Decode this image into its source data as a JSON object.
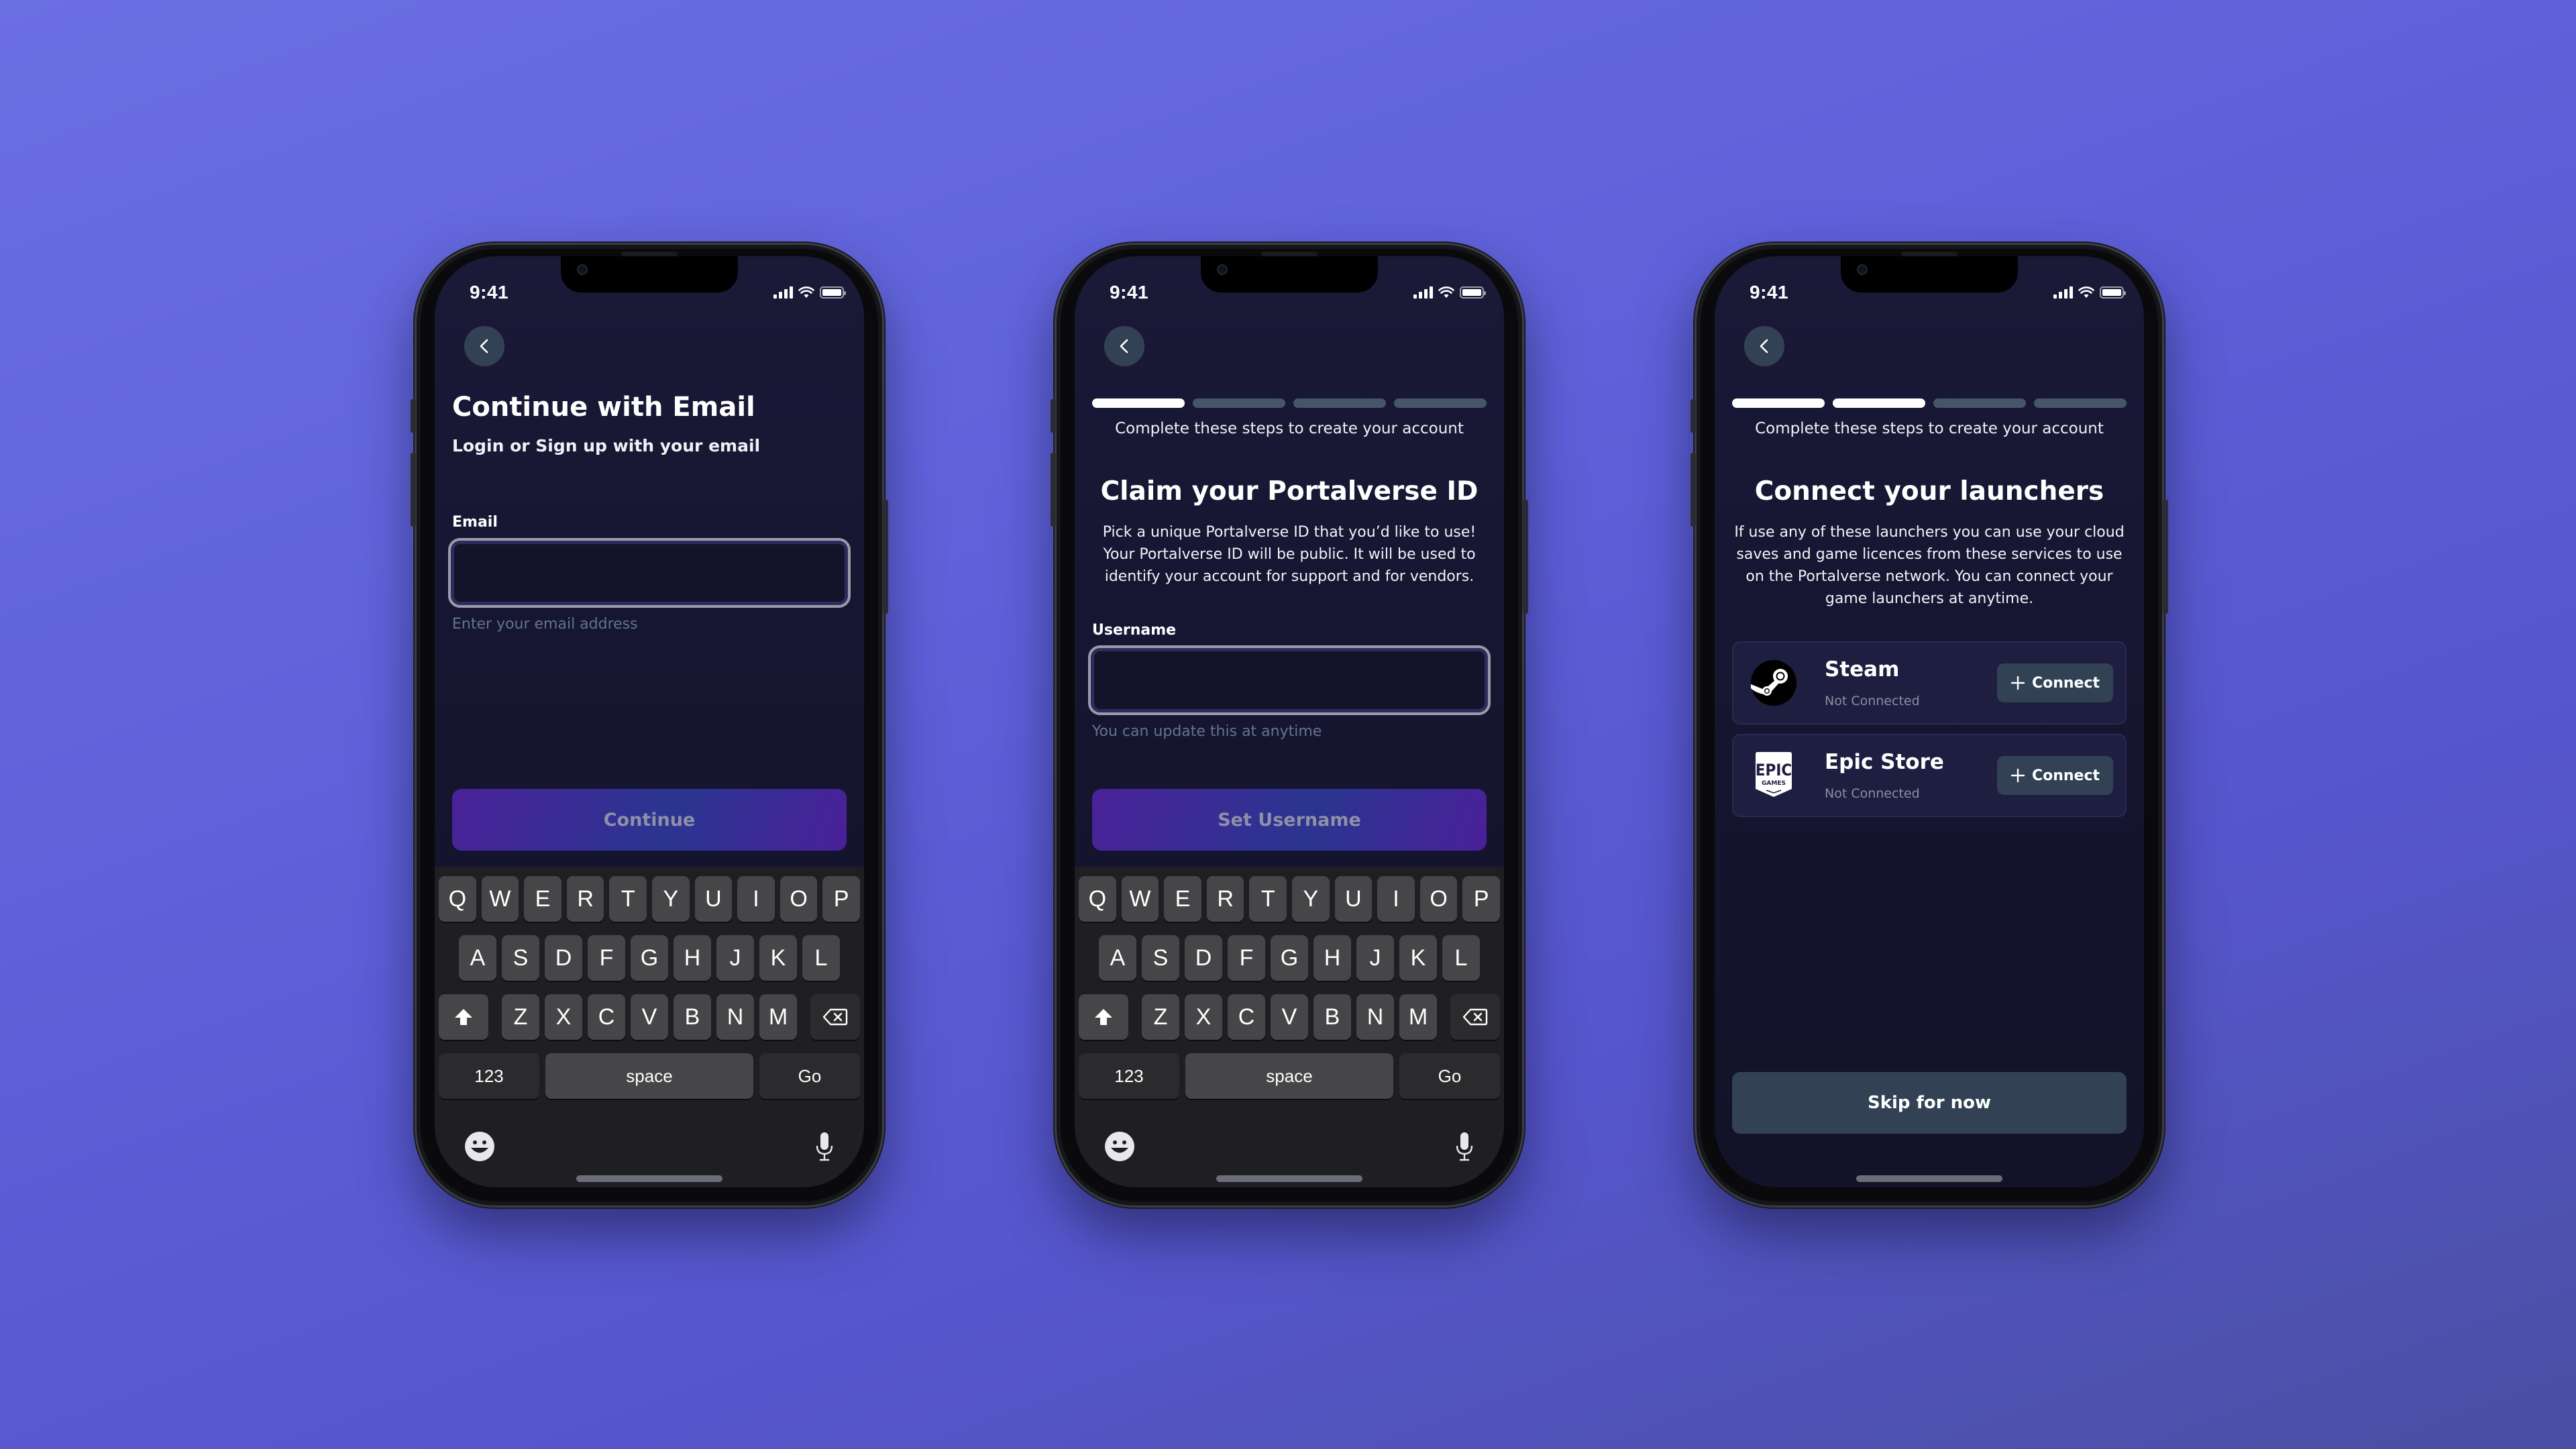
{
  "colors": {
    "background_start": "#6a6fe2",
    "background_end": "#4a4fa2",
    "screen_bg": "#161632",
    "progress_done": "#ffffff",
    "progress_todo": "#475569",
    "secondary_button": "#334155",
    "hint_text": "#64748b"
  },
  "status_bar": {
    "time": "9:41",
    "icons": [
      "cellular-signal-icon",
      "wifi-icon",
      "battery-icon"
    ]
  },
  "keyboard": {
    "row1": [
      "Q",
      "W",
      "E",
      "R",
      "T",
      "Y",
      "U",
      "I",
      "O",
      "P"
    ],
    "row2": [
      "A",
      "S",
      "D",
      "F",
      "G",
      "H",
      "J",
      "K",
      "L"
    ],
    "row3": [
      "Z",
      "X",
      "C",
      "V",
      "B",
      "N",
      "M"
    ],
    "numbers_label": "123",
    "space_label": "space",
    "go_label": "Go",
    "icons": [
      "shift-icon",
      "backspace-icon",
      "emoji-icon",
      "microphone-icon"
    ]
  },
  "screens": {
    "email": {
      "back_icon": "chevron-left-icon",
      "title": "Continue with Email",
      "subtitle": "Login or Sign up with your email",
      "field_label": "Email",
      "field_value": "",
      "field_hint": "Enter your email address",
      "button_label": "Continue"
    },
    "username": {
      "back_icon": "chevron-left-icon",
      "progress": {
        "current_step": 1,
        "total_steps": 4
      },
      "steps_caption": "Complete these steps to create your account",
      "title": "Claim your Portalverse ID",
      "description": "Pick a unique Portalverse ID that you’d like to use! Your Portalverse ID will be public. It will be used to identify your account for support and for vendors.",
      "field_label": "Username",
      "field_value": "",
      "field_hint": "You can update this at anytime",
      "button_label": "Set Username"
    },
    "launchers": {
      "back_icon": "chevron-left-icon",
      "progress": {
        "current_step": 2,
        "total_steps": 4
      },
      "steps_caption": "Complete these steps to create your account",
      "title": "Connect your launchers",
      "description": "If use any of these launchers you can use your cloud saves and game licences from these services to use on the Portalverse network. You can connect your game launchers at anytime.",
      "items": [
        {
          "name": "Steam",
          "status": "Not Connected",
          "icon": "steam-logo-icon",
          "button_label": "Connect"
        },
        {
          "name": "Epic Store",
          "status": "Not Connected",
          "icon": "epic-games-logo-icon",
          "button_label": "Connect",
          "logo_text_top": "EPIC",
          "logo_text_bottom": "GAMES"
        }
      ],
      "skip_label": "Skip for now"
    }
  }
}
